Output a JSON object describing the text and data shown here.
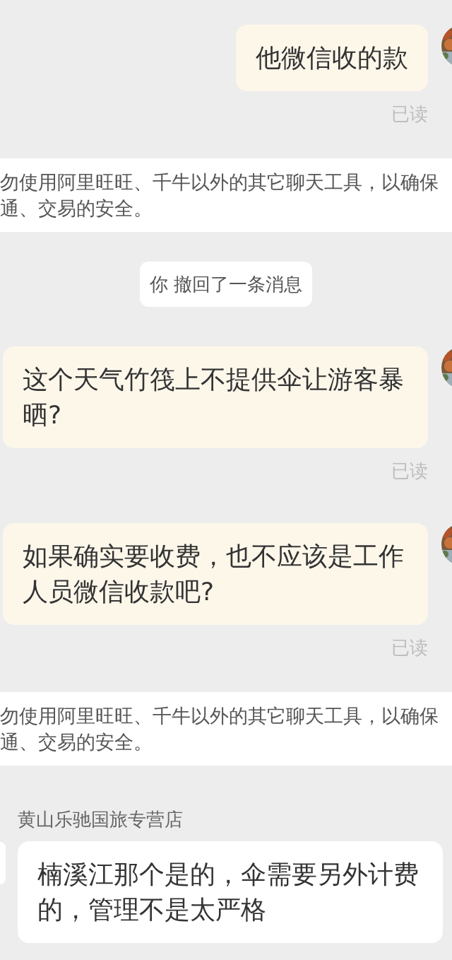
{
  "messages": [
    {
      "kind": "outgoing",
      "text": "他微信收的款",
      "status": "已读"
    },
    {
      "kind": "notice",
      "text": "勿使用阿里旺旺、千牛以外的其它聊天工具，以确保通、交易的安全。"
    },
    {
      "kind": "recall",
      "text": "你 撤回了一条消息"
    },
    {
      "kind": "outgoing",
      "text": "这个天气竹筏上不提供伞让游客暴晒?",
      "status": "已读"
    },
    {
      "kind": "outgoing",
      "text": "如果确实要收费，也不应该是工作人员微信收款吧?",
      "status": "已读"
    },
    {
      "kind": "notice",
      "text": "勿使用阿里旺旺、千牛以外的其它聊天工具，以确保通、交易的安全。"
    },
    {
      "kind": "incoming",
      "sender": "黄山乐驰国旅专营店",
      "text": "楠溪江那个是的，伞需要另外计费的，管理不是太严格"
    }
  ]
}
